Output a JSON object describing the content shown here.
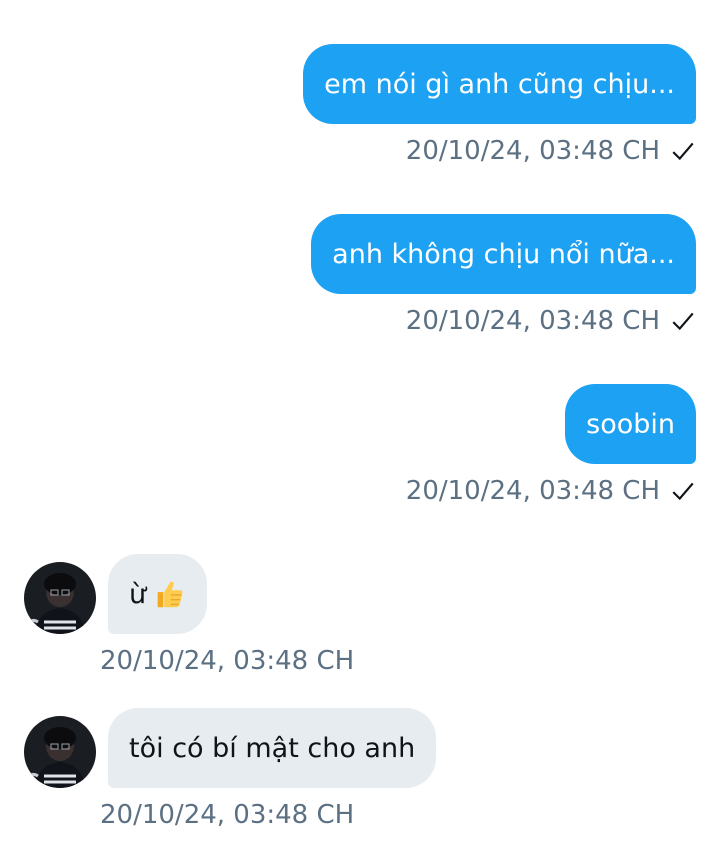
{
  "messages_out": [
    {
      "text": "em nói gì anh cũng chịu...",
      "time": "20/10/24, 03:48 CH"
    },
    {
      "text": "anh không chịu nổi nữa...",
      "time": "20/10/24, 03:48 CH"
    },
    {
      "text": "soobin",
      "time": "20/10/24, 03:48 CH"
    }
  ],
  "messages_in": [
    {
      "text": "ừ",
      "emoji": "thumbs-up-emoji",
      "time": "20/10/24, 03:48 CH"
    },
    {
      "text": "tôi có bí mật cho anh",
      "time": "20/10/24, 03:48 CH"
    }
  ],
  "colors": {
    "outgoing_bubble": "#1da1f2",
    "incoming_bubble": "#e7ecf0",
    "meta_text": "#5b7083"
  },
  "icons": {
    "sent_status": "checkmark-icon",
    "avatar": "user-avatar"
  }
}
